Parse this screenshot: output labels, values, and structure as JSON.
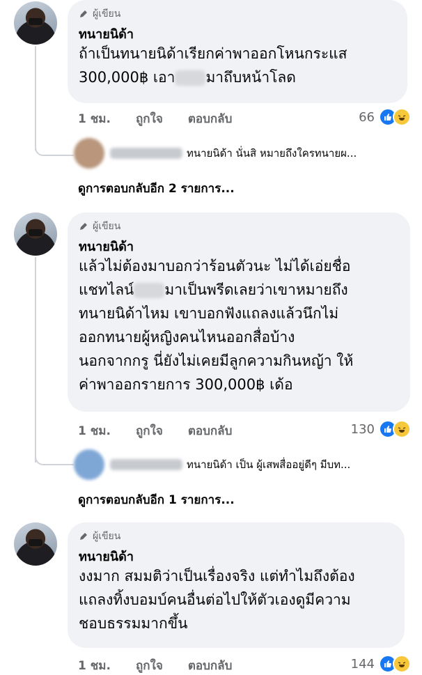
{
  "comments": [
    {
      "badge": "ผู้เขียน",
      "author": "ทนายนิด้า",
      "text_before": "ถ้าเป็นทนายนิด้าเรียกค่าพาออกโหนกระแส\n300,000฿ เอา",
      "text_after": "มาถึบหน้าโลด",
      "time": "1 ชม.",
      "like_label": "ถูกใจ",
      "reply_label": "ตอบกลับ",
      "reaction_count": "66",
      "reply_preview": "ทนายนิด้า นั่นสิ หมายถึงใครทนายผ...",
      "more_replies": "ดูการตอบกลับอีก 2 รายการ..."
    },
    {
      "badge": "ผู้เขียน",
      "author": "ทนายนิด้า",
      "text_before": "แล้วไม่ต้องมาบอกว่าร้อนตัวนะ ไม่ได้เอ่ยชื่อ\nแชทไลน์",
      "text_after": "มาเป็นพรีดเลยว่าเขาหมายถึง\nทนายนิด้าไหม เขาบอกฟังแถลงแล้วนึกไม่\nออกทนายผู้หญิงคนไหนออกสื่อบ้าง\nนอกจากกรู นี่ยังไม่เคยมีลูกความกินหญ้า ให้\nค่าพาออกรายการ 300,000฿ เด้อ",
      "time": "1 ชม.",
      "like_label": "ถูกใจ",
      "reply_label": "ตอบกลับ",
      "reaction_count": "130",
      "reply_preview": "ทนายนิด้า เป็น ผู้เสพสื่ออยู่ดีๆ มีบท...",
      "more_replies": "ดูการตอบกลับอีก 1 รายการ..."
    },
    {
      "badge": "ผู้เขียน",
      "author": "ทนายนิด้า",
      "text_before": "งงมาก สมมติว่าเป็นเรื่องจริง แต่ทำไมถึงต้อง\nแถลงทิ้งบอมบ์คนอื่นต่อไปให้ตัวเองดูมีความ\nชอบธรรมมากขึ้น",
      "text_after": "",
      "time": "1 ชม.",
      "like_label": "ถูกใจ",
      "reply_label": "ตอบกลับ",
      "reaction_count": "144"
    }
  ],
  "colors": {
    "bubble": "#f0f2f5",
    "like_blue": "#1877f2",
    "haha_yellow": "#f7c83c",
    "meta_gray": "#65676b"
  }
}
